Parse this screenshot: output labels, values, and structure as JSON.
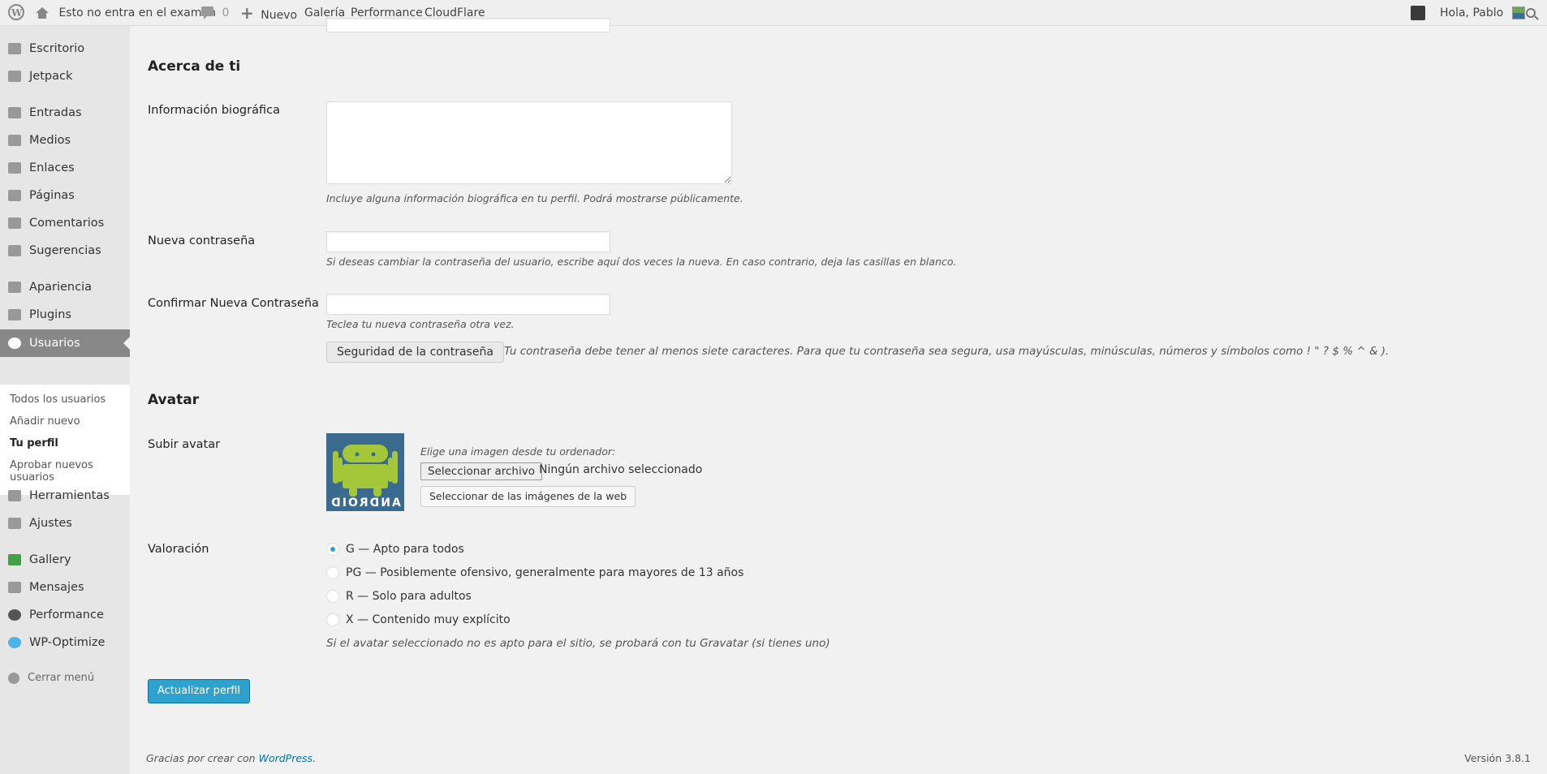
{
  "adminbar": {
    "site_name": "Esto no entra en el examen",
    "comments_count": "0",
    "new_label": "Nuevo",
    "links": [
      "Galería",
      "Performance",
      "CloudFlare"
    ],
    "greeting": "Hola, Pablo"
  },
  "sidebar": {
    "items": [
      {
        "label": "Escritorio",
        "icon": "dashboard-icon"
      },
      {
        "label": "Jetpack",
        "icon": "jetpack-icon"
      },
      {
        "label": "Entradas",
        "icon": "pin-icon"
      },
      {
        "label": "Medios",
        "icon": "media-icon"
      },
      {
        "label": "Enlaces",
        "icon": "link-icon"
      },
      {
        "label": "Páginas",
        "icon": "page-icon"
      },
      {
        "label": "Comentarios",
        "icon": "comment-icon"
      },
      {
        "label": "Sugerencias",
        "icon": "feedback-icon"
      },
      {
        "label": "Apariencia",
        "icon": "brush-icon"
      },
      {
        "label": "Plugins",
        "icon": "plugin-icon"
      },
      {
        "label": "Usuarios",
        "icon": "user-icon"
      },
      {
        "label": "Herramientas",
        "icon": "wrench-icon"
      },
      {
        "label": "Ajustes",
        "icon": "settings-icon"
      },
      {
        "label": "Gallery",
        "icon": "gallery-icon"
      },
      {
        "label": "Mensajes",
        "icon": "mail-icon"
      },
      {
        "label": "Performance",
        "icon": "performance-icon"
      },
      {
        "label": "WP-Optimize",
        "icon": "optimize-icon"
      }
    ],
    "submenu": [
      "Todos los usuarios",
      "Añadir nuevo",
      "Tu perfil",
      "Aprobar nuevos usuarios"
    ],
    "collapse_label": "Cerrar menú"
  },
  "about": {
    "title": "Acerca de ti",
    "bio_label": "Información biográfica",
    "bio_value": "",
    "bio_desc": "Incluye alguna información biográfica en tu perfil. Podrá mostrarse públicamente.",
    "new_pass_label": "Nueva contraseña",
    "new_pass_desc": "Si deseas cambiar la contraseña del usuario, escribe aquí dos veces la nueva. En caso contrario, deja las casillas en blanco.",
    "confirm_pass_label": "Confirmar Nueva Contraseña",
    "confirm_pass_desc": "Teclea tu nueva contraseña otra vez.",
    "strength_button": "Seguridad de la contraseña",
    "strength_hint": "Tu contraseña debe tener al menos siete caracteres. Para que tu contraseña sea segura, usa mayúsculas, minúsculas, números y símbolos como ! \" ? $ % ^ & )."
  },
  "avatar": {
    "title": "Avatar",
    "upload_label": "Subir avatar",
    "image_text": "ANDROID",
    "choose_hint": "Elige una imagen desde tu ordenador:",
    "file_button": "Seleccionar archivo",
    "no_file": "Ningún archivo seleccionado",
    "web_button": "Seleccionar de las imágenes de la web",
    "rating_label": "Valoración",
    "ratings": [
      {
        "label": "G — Apto para todos",
        "checked": true
      },
      {
        "label": "PG — Posiblemente ofensivo, generalmente para mayores de 13 años",
        "checked": false
      },
      {
        "label": "R — Solo para adultos",
        "checked": false
      },
      {
        "label": "X — Contenido muy explícito",
        "checked": false
      }
    ],
    "rating_desc": "Si el avatar seleccionado no es apto para el sitio, se probará con tu Gravatar (si tienes uno)"
  },
  "submit_label": "Actualizar perfil",
  "footer": {
    "thanks_prefix": "Gracias por crear con",
    "thanks_link": "WordPress",
    "thanks_suffix": ".",
    "version": "Versión 3.8.1"
  },
  "colors": {
    "accent": "#2ea2cc",
    "sidebar_bg": "#e6e6e6",
    "current_menu": "#888888",
    "page_bg": "#f1f1f1"
  }
}
